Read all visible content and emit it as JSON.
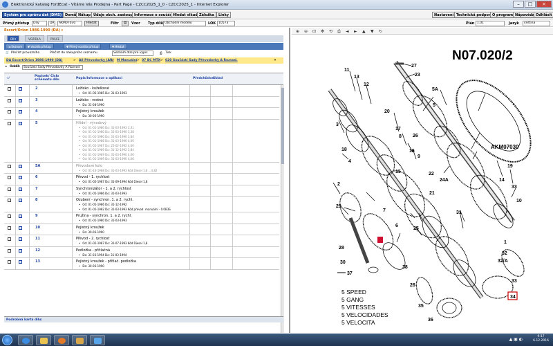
{
  "window": {
    "title": "Elektronický katalog FordEcat - Vítáme Vás Prodejna - Part Page - CZCC2025_1_0 - CZCC2025_1 - Internet Explorer"
  },
  "menubar": {
    "left_items": [
      "Systém pro správu dat (DMS)",
      "Domů",
      "Nákup",
      "Údaje obch. zastoupení",
      "Informace o součásti",
      "Hledat vikuda",
      "Záložka",
      "Linky"
    ],
    "right_items": [
      "Nastavení",
      "Technická podpora",
      "O programu",
      "Nápověda",
      "Odhlásit se"
    ]
  },
  "filterbar": {
    "type_label": "Přímý přístup",
    "type_value": "Díly",
    "market_value": "DA",
    "code_value": "AKM07030",
    "search_label": "Hledat",
    "filter_label": "Filtr",
    "view_label": "Vzor",
    "type_dil_label": "Typ dílů",
    "type_dil_value": "Obchodní modely",
    "lok_label": "LOK",
    "lok_value": "10573",
    "year_label": "Plán",
    "year_value": "1.01",
    "lang_label": "Jazyk",
    "lang_value": "čeština"
  },
  "left": {
    "model_line": "Escort/Orion 1986-1990 (DA) ▾",
    "tabs": [
      "DÍLY",
      "VOZIDLA",
      "PRÁCE"
    ],
    "vehicle_buttons": [
      "◄ Seznam",
      "▼ Vozidla přístup",
      "▼ Přímý vozidla přístup",
      "▼ Hledat"
    ],
    "tool_items": [
      "Přečíst provozního",
      "Přečíst do nákupního seznamu",
      "Seznam přípravy",
      "Tisk"
    ],
    "tool_select": "Seznam dílů pro výpis",
    "breadcrumb": [
      "DA Escort/Orion 1986-1990 (DA)",
      "All Převodovky (AR)",
      "M Manuální",
      "07 BC MTX",
      "020 Součástí Sady Převodovky A Rozvod."
    ],
    "oddil_label": "Oddíl:",
    "oddil_value": "Součásti Sady Převodovky A Rozvod",
    "headers": {
      "pos": "Popisek/ Číslo schématu dílu",
      "desc": "Popis/Informace o aplikaci",
      "prev": "Předchůdce",
      "qty": "Sklad"
    },
    "rows": [
      {
        "pos": "2",
        "name": "Ložisko - kuželkové",
        "gray": false,
        "details": [
          "Od: 01-05-1985 Do: 31-03-1993"
        ]
      },
      {
        "pos": "3",
        "name": "Ložisko - vratné",
        "gray": false,
        "details": [
          "Do: 31-08-1990"
        ]
      },
      {
        "pos": "4",
        "name": "Pojistný kroužek",
        "gray": false,
        "details": [
          "Do: 30-06-1990"
        ]
      },
      {
        "pos": "5",
        "name": "Hřídel - vývodový",
        "gray": true,
        "details": [
          "Od: 01-01-1980 Do: 31-03-1993 3,31",
          "Od: 01-01-1980 Do: 31-03-1990 3,38",
          "Od: 01-01-1980 Do: 31-03-1990 3,84",
          "Od: 01-01-1986 Do: 31-03-1990 4,06",
          "Od: 01-02-1987 Do: 25-02-1992 4,06",
          "Od: 01-01-1989 Do: 31-12-1992 3,84",
          "Od: 01-01-1989 Do: 31-03-1990 4,06",
          "Od: 01-01-1989 Do: 31-03-1990 4,06"
        ]
      },
      {
        "pos": "5A",
        "name": "Převodové kolo",
        "gray": true,
        "details": [
          "Od: 01-10-1988 Do: 31-03-1993 Kód Diesel 1,8 ...3,82"
        ]
      },
      {
        "pos": "6",
        "name": "Převod - 1. rychlost",
        "gray": false,
        "details": [
          "Od: 01-02-1987 Do: 31-09-1994 Kód Diesel 1,8"
        ]
      },
      {
        "pos": "7",
        "name": "Synchronizátor - 1. a 2. rychlost",
        "gray": false,
        "details": [
          "Od: 01-05-1986 Do: 31-03-1993"
        ]
      },
      {
        "pos": "8",
        "name": "Ozubení - synchron. 1. a 2. rychl.",
        "gray": false,
        "details": [
          "Od: 01-05-1986 Do: 31-12-1992",
          "Od: 01-02-1982 Do: 31-03-1993 Kód převod. manuální - 0.0B3S"
        ]
      },
      {
        "pos": "9",
        "name": "Pružina - synchron. 1. a 2. rychl.",
        "gray": false,
        "details": [
          "Od: 01-01-1980 Do: 31-03-1993"
        ]
      },
      {
        "pos": "10",
        "name": "Pojistný kroužek",
        "gray": false,
        "details": [
          "Do: 30-06-1990"
        ]
      },
      {
        "pos": "11",
        "name": "Převod - 2. rychlost",
        "gray": false,
        "details": [
          "Od: 01-02-1987 Do: 31-07-1993 Kód Diesel 1,8"
        ]
      },
      {
        "pos": "12",
        "name": "Podložka - přítlačná",
        "gray": false,
        "details": [
          "Do: 31-03-1994 Do: 31-03-1994"
        ]
      },
      {
        "pos": "13",
        "name": "Pojistný kroužek - přítlač. podložka",
        "gray": false,
        "details": [
          "Do: 30-06-1990"
        ]
      }
    ],
    "bottom_label": "Podrobná karta dílu:"
  },
  "right": {
    "diagram_title": "N07.020/2",
    "ref_code": "AKM07030",
    "callouts": [
      "11",
      "13",
      "12",
      "27",
      "23",
      "3",
      "20",
      "5A",
      "5",
      "26",
      "18",
      "8",
      "17",
      "16",
      "9",
      "4",
      "22",
      "15",
      "2",
      "19",
      "24A",
      "21",
      "33",
      "29",
      "7",
      "6",
      "14",
      "25",
      "31",
      "32",
      "10",
      "1",
      "28",
      "30",
      "37",
      "38",
      "32/A",
      "34",
      "26",
      "35",
      "36"
    ],
    "legend": [
      "5 SPEED",
      "5 GANG",
      "5 VITESSES",
      "5 VELOCIDADES",
      "5 VELOCITA"
    ]
  },
  "taskbar": {
    "time": "9:17",
    "date": "6.12.2016"
  }
}
